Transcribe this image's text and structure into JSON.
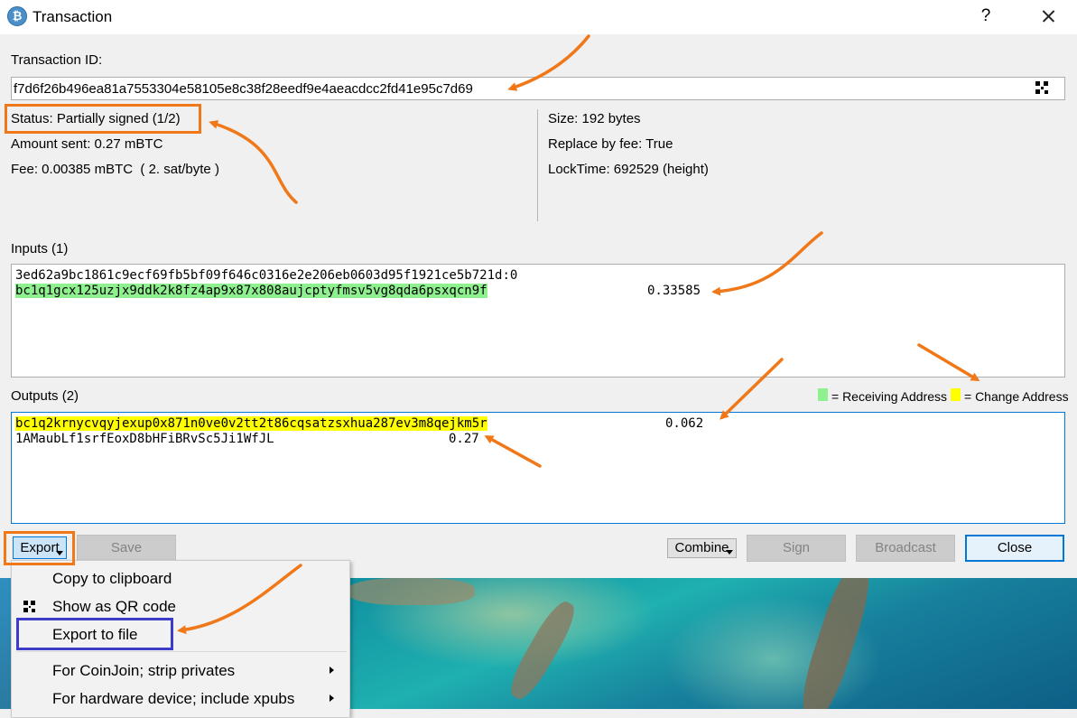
{
  "window": {
    "title": "Transaction",
    "help": "?"
  },
  "txid": {
    "label": "Transaction ID:",
    "value": "f7d6f26b496ea81a7553304e58105e8c38f28eedf9e4aeacdcc2fd41e95c7d69"
  },
  "info_left": {
    "status": "Status: Partially signed (1/2)",
    "amount": "Amount sent: 0.27 mBTC",
    "fee": "Fee: 0.00385 mBTC  ( 2. sat/byte )"
  },
  "info_right": {
    "size": "Size: 192 bytes",
    "rbf": "Replace by fee: True",
    "locktime": "LockTime: 692529 (height)"
  },
  "inputs": {
    "label": "Inputs (1)",
    "rows": [
      {
        "prevout": "3ed62a9bc1861c9ecf69fb5bf09f646c0316e2e206eb0603d95f1921ce5b721d:0",
        "address": "bc1q1gcx125uzjx9ddk2k8fz4ap9x87x808aujcptyfmsv5vg8qda6psxqcn9f",
        "amount": "0.33585"
      }
    ]
  },
  "outputs": {
    "label": "Outputs (2)",
    "rows": [
      {
        "address": "bc1q2krnycvqyjexup0x871n0ve0v2tt2t86cqsatzsxhua287ev3m8qejkm5r",
        "amount": "0.062"
      },
      {
        "address": "1AMaubLf1srfEoxD8bHFiBRvSc5Ji1WfJL",
        "amount": "0.27"
      }
    ]
  },
  "legend": {
    "receiving": "= Receiving Address",
    "change": "= Change Address",
    "receiving_color": "#8ff08f",
    "change_color": "#ffff00"
  },
  "buttons": {
    "export": "Export",
    "save": "Save",
    "combine": "Combine",
    "sign": "Sign",
    "broadcast": "Broadcast",
    "close": "Close"
  },
  "menu": {
    "copy": "Copy to clipboard",
    "qr": "Show as QR code",
    "file": "Export to file",
    "coinjoin": "For CoinJoin; strip privates",
    "hardware": "For hardware device; include xpubs"
  },
  "annotation_color": "#f07818"
}
